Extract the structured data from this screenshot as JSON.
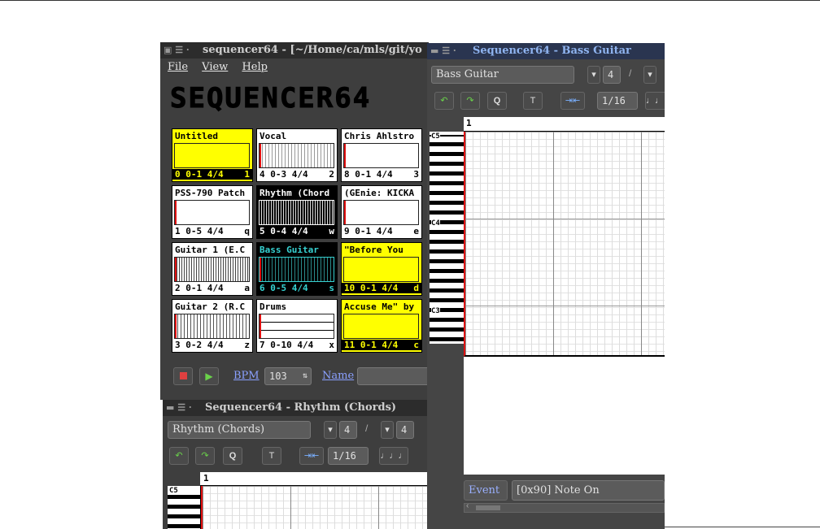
{
  "main_window": {
    "title": "sequencer64 - [~/Home/ca/mls/git/yo",
    "menu": [
      "File",
      "View",
      "Help"
    ],
    "logo": "SEQUENCER64",
    "slots": [
      {
        "name": "Untitled",
        "info": "0  0-1 4/4",
        "key": "1"
      },
      {
        "name": "Vocal",
        "info": "4  0-3 4/4",
        "key": "2"
      },
      {
        "name": "Chris Ahlstro",
        "info": "8  0-1 4/4",
        "key": "3"
      },
      {
        "name": "PSS-790 Patch",
        "info": "1  0-5 4/4",
        "key": "q"
      },
      {
        "name": "Rhythm (Chord",
        "info": "5  0-4 4/4",
        "key": "w"
      },
      {
        "name": "(GEnie: KICKA",
        "info": "9  0-1 4/4",
        "key": "e"
      },
      {
        "name": "Guitar 1 (E.C",
        "info": "2  0-1 4/4",
        "key": "a"
      },
      {
        "name": "Bass Guitar",
        "info": "6  0-5 4/4",
        "key": "s"
      },
      {
        "name": "\"Before You",
        "info": "10 0-1 4/4",
        "key": "d"
      },
      {
        "name": "Guitar 2 (R.C",
        "info": "3  0-2 4/4",
        "key": "z"
      },
      {
        "name": "Drums",
        "info": "7  0-10 4/4",
        "key": "x"
      },
      {
        "name": "Accuse Me\" by",
        "info": "11 0-1 4/4",
        "key": "c"
      }
    ],
    "bpm_label": "BPM",
    "bpm_value": "103",
    "name_label": "Name"
  },
  "bass_window": {
    "title": "Sequencer64 - Bass Guitar",
    "seq_name": "Bass Guitar",
    "beats": "4",
    "snap": "1/16",
    "measure": "1",
    "notes": [
      "C5",
      "C4",
      "C3"
    ],
    "event_label": "Event",
    "event_value": "[0x90] Note On"
  },
  "rhythm_window": {
    "title": "Sequencer64 - Rhythm (Chords)",
    "seq_name": "Rhythm (Chords)",
    "beats": "4",
    "beats2": "4",
    "snap": "1/16",
    "measure": "1",
    "note": "C5"
  },
  "colors": {
    "yellow": "#ffff00",
    "cyan": "#37d2d2",
    "red": "#e01010",
    "title_active": "#8fb4f0"
  }
}
